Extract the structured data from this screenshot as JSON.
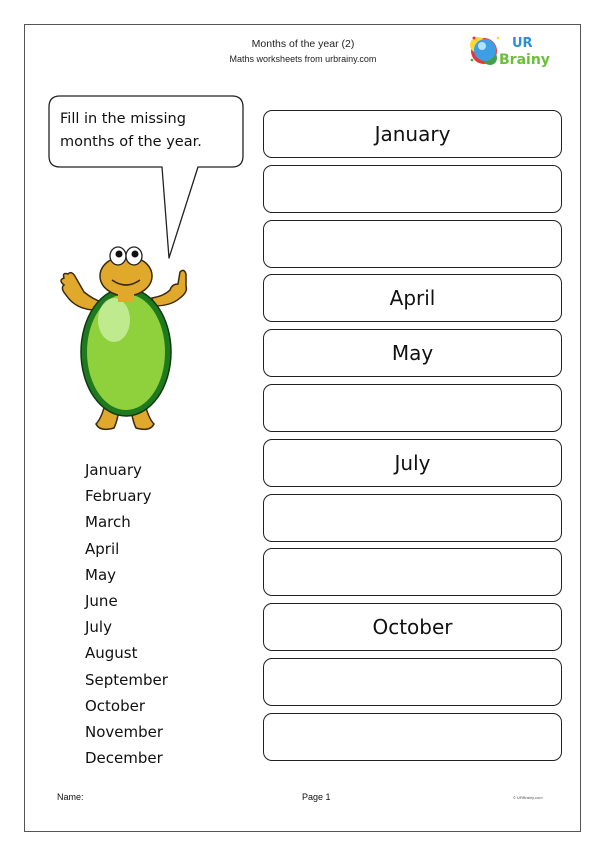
{
  "header": {
    "title": "Months of the year (2)",
    "subtitle": "Maths worksheets from urbrainy.com",
    "logo": {
      "top_text": "UR",
      "bottom_text": "Brainy"
    }
  },
  "speech_bubble": {
    "line1": "Fill in the missing",
    "line2": "months of the year."
  },
  "reference_months": [
    "January",
    "February",
    "March",
    "April",
    "May",
    "June",
    "July",
    "August",
    "September",
    "October",
    "November",
    "December"
  ],
  "answer_boxes": [
    {
      "value": "January"
    },
    {
      "value": ""
    },
    {
      "value": ""
    },
    {
      "value": "April"
    },
    {
      "value": "May"
    },
    {
      "value": ""
    },
    {
      "value": "July"
    },
    {
      "value": ""
    },
    {
      "value": ""
    },
    {
      "value": "October"
    },
    {
      "value": ""
    },
    {
      "value": ""
    }
  ],
  "footer": {
    "name_label": "Name:",
    "page_label": "Page 1",
    "copyright": "© URBrainy.com"
  },
  "colors": {
    "turtle_shell": "#8ed13c",
    "turtle_rim": "#1f7a1f",
    "turtle_skin": "#e0a92b",
    "logo_blue": "#2a8fd6",
    "logo_green": "#6cbf3a"
  }
}
